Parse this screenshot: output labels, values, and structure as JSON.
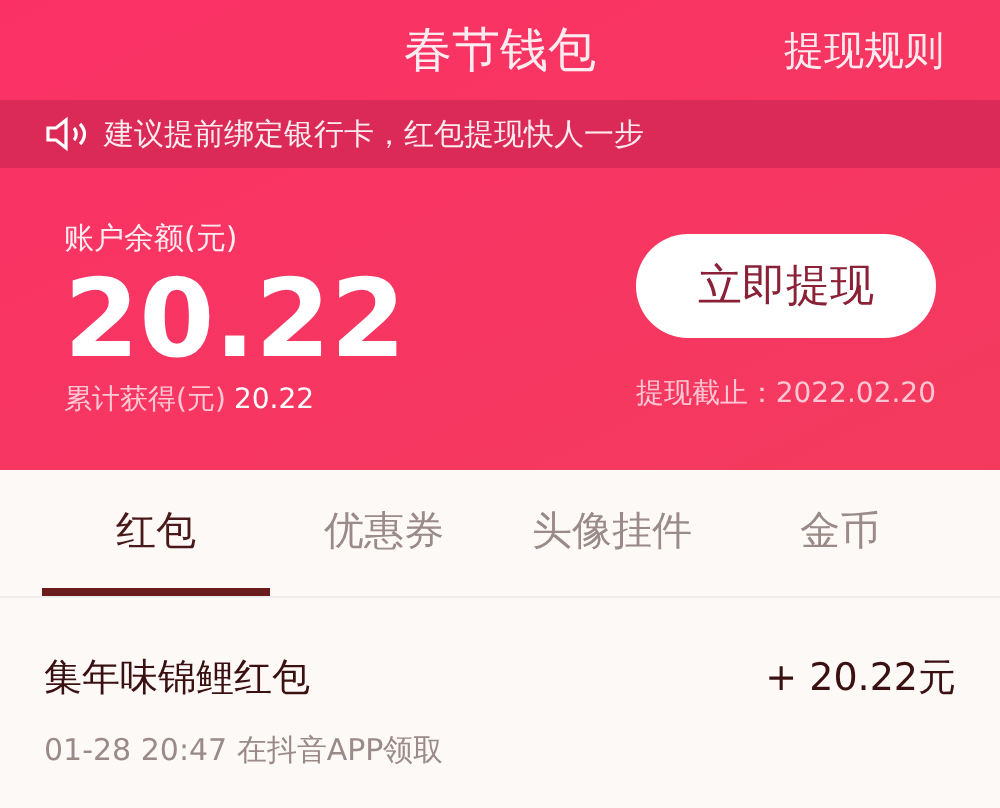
{
  "header": {
    "title": "春节钱包",
    "rules_link": "提现规则"
  },
  "notice": "建议提前绑定银行卡，红包提现快人一步",
  "balance": {
    "label": "账户余额(元)",
    "amount": "20.22",
    "total_label": "累计获得(元)",
    "total": "20.22",
    "button": "立即提现",
    "deadline": "提现截止：2022.02.20"
  },
  "tabs": [
    {
      "label": "红包",
      "selected": true
    },
    {
      "label": "优惠券",
      "selected": false
    },
    {
      "label": "头像挂件",
      "selected": false
    },
    {
      "label": "金币",
      "selected": false
    }
  ],
  "records": [
    {
      "title": "集年味锦鲤红包",
      "time": "01-28 20:47 在抖音APP领取",
      "amount": "+ 20.22元"
    }
  ]
}
